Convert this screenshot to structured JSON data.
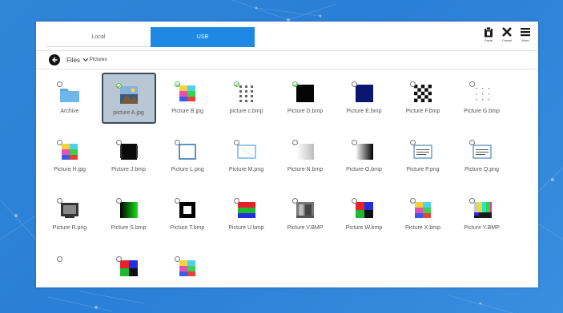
{
  "tabs": [
    {
      "label": "Local",
      "active": false
    },
    {
      "label": "USB",
      "active": true
    }
  ],
  "actions": [
    {
      "label": "Paste",
      "icon": "clipboard-icon"
    },
    {
      "label": "Cancel",
      "icon": "close-icon"
    },
    {
      "label": "More",
      "icon": "menu-icon"
    }
  ],
  "breadcrumb": {
    "root": "Files",
    "current": "Pictures"
  },
  "colors": {
    "accent": "#1f88e5",
    "background": "#2f86d8",
    "selected": "#b9c6d3"
  },
  "files": [
    {
      "name": "Archive",
      "type": "folder",
      "checked": false,
      "selected": false
    },
    {
      "name": "picture A.jpg",
      "type": "photo",
      "checked": true,
      "selected": true
    },
    {
      "name": "Picture B.jpg",
      "type": "colorbars",
      "checked": true,
      "selected": false
    },
    {
      "name": "picture c.bmp",
      "type": "dotgrid",
      "checked": true,
      "selected": false
    },
    {
      "name": "Picture D.bmp",
      "type": "black",
      "checked": true,
      "selected": false
    },
    {
      "name": "Picture E.bmp",
      "type": "navy",
      "checked": false,
      "selected": false
    },
    {
      "name": "Picture F.bmp",
      "type": "checker",
      "checked": false,
      "selected": false
    },
    {
      "name": "Picture G.bmp",
      "type": "dots",
      "checked": false,
      "selected": false
    },
    {
      "name": "Picture H.jpg",
      "type": "colorbars",
      "checked": false,
      "selected": false
    },
    {
      "name": "Picture J.bmp",
      "type": "blackblock",
      "checked": false,
      "selected": false
    },
    {
      "name": "Picture L.png",
      "type": "frame",
      "checked": false,
      "selected": false
    },
    {
      "name": "Picture M.png",
      "type": "frame2",
      "checked": false,
      "selected": false
    },
    {
      "name": "Picture N.bmp",
      "type": "gradgray",
      "checked": false,
      "selected": false
    },
    {
      "name": "Picture O.bmp",
      "type": "gradblack",
      "checked": false,
      "selected": false
    },
    {
      "name": "Picture P.png",
      "type": "textframe",
      "checked": false,
      "selected": false
    },
    {
      "name": "Picture Q.png",
      "type": "textframe",
      "checked": false,
      "selected": false
    },
    {
      "name": "Picture R.png",
      "type": "monitor",
      "checked": false,
      "selected": false
    },
    {
      "name": "Picture S.bmp",
      "type": "gradgreen",
      "checked": false,
      "selected": false
    },
    {
      "name": "Picture T.bmp",
      "type": "square",
      "checked": false,
      "selected": false
    },
    {
      "name": "Picture U.bmp",
      "type": "rgbstripes",
      "checked": false,
      "selected": false
    },
    {
      "name": "Picture V.BMP",
      "type": "photo2",
      "checked": false,
      "selected": false
    },
    {
      "name": "Picture W.bmp",
      "type": "quad",
      "checked": false,
      "selected": false
    },
    {
      "name": "Picture X.bmp",
      "type": "colorbars",
      "checked": false,
      "selected": false
    },
    {
      "name": "Picture Y.BMP",
      "type": "testcard",
      "checked": false,
      "selected": false
    },
    {
      "name": "",
      "type": "none",
      "checked": false,
      "selected": false
    },
    {
      "name": "",
      "type": "quad",
      "checked": false,
      "selected": false
    },
    {
      "name": "",
      "type": "colorbars",
      "checked": false,
      "selected": false
    }
  ]
}
